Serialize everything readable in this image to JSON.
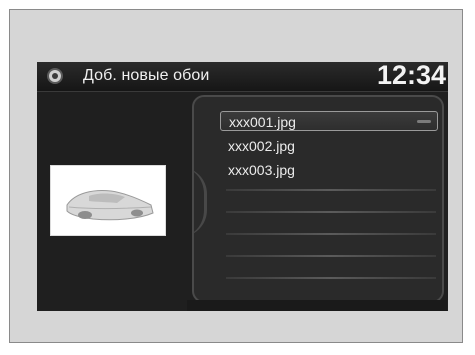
{
  "header": {
    "title": "Доб. новые обои",
    "time": "12:34"
  },
  "file_list": {
    "items": [
      {
        "label": "xxx001.jpg",
        "selected": true
      },
      {
        "label": "xxx002.jpg",
        "selected": false
      },
      {
        "label": "xxx003.jpg",
        "selected": false
      }
    ],
    "empty_rows": 5
  },
  "preview": {
    "icon": "car-thumbnail"
  },
  "icons": {
    "header_icon": "settings-icon"
  }
}
